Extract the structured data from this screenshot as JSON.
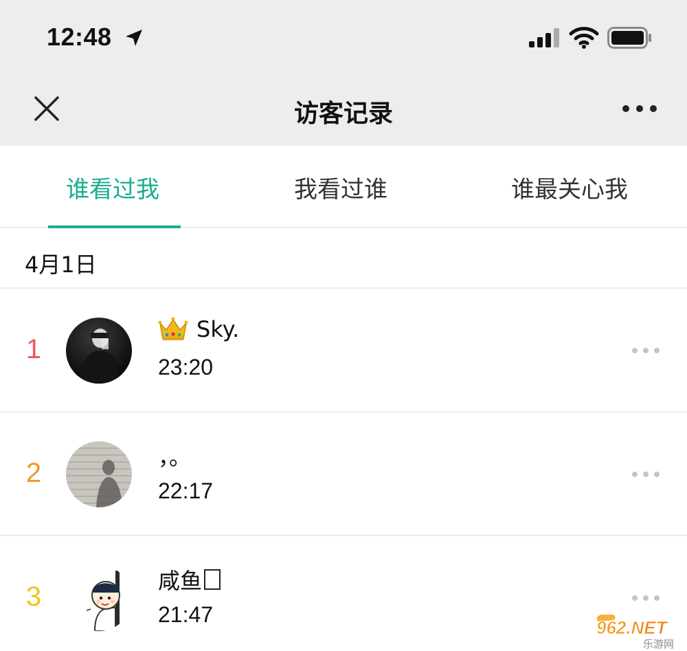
{
  "status_bar": {
    "time": "12:48"
  },
  "nav": {
    "title": "访客记录"
  },
  "tabs": [
    {
      "label": "谁看过我",
      "active": true
    },
    {
      "label": "我看过谁",
      "active": false
    },
    {
      "label": "谁最关心我",
      "active": false
    }
  ],
  "section": {
    "date": "4月1日"
  },
  "visitors": [
    {
      "rank": "1",
      "rank_color": "#f05a5a",
      "name": "Sky.",
      "badge": "crown",
      "time": "23:20"
    },
    {
      "rank": "2",
      "rank_color": "#f3962c",
      "name": "，。",
      "time": "22:17"
    },
    {
      "rank": "3",
      "rank_color": "#f4c21c",
      "name": "咸鱼",
      "time": "21:47"
    }
  ],
  "watermark": {
    "text": "962.NET",
    "subtext": "乐游网"
  },
  "colors": {
    "accent": "#1aad8f",
    "header_bg": "#ededed",
    "divider": "#ebebeb"
  }
}
